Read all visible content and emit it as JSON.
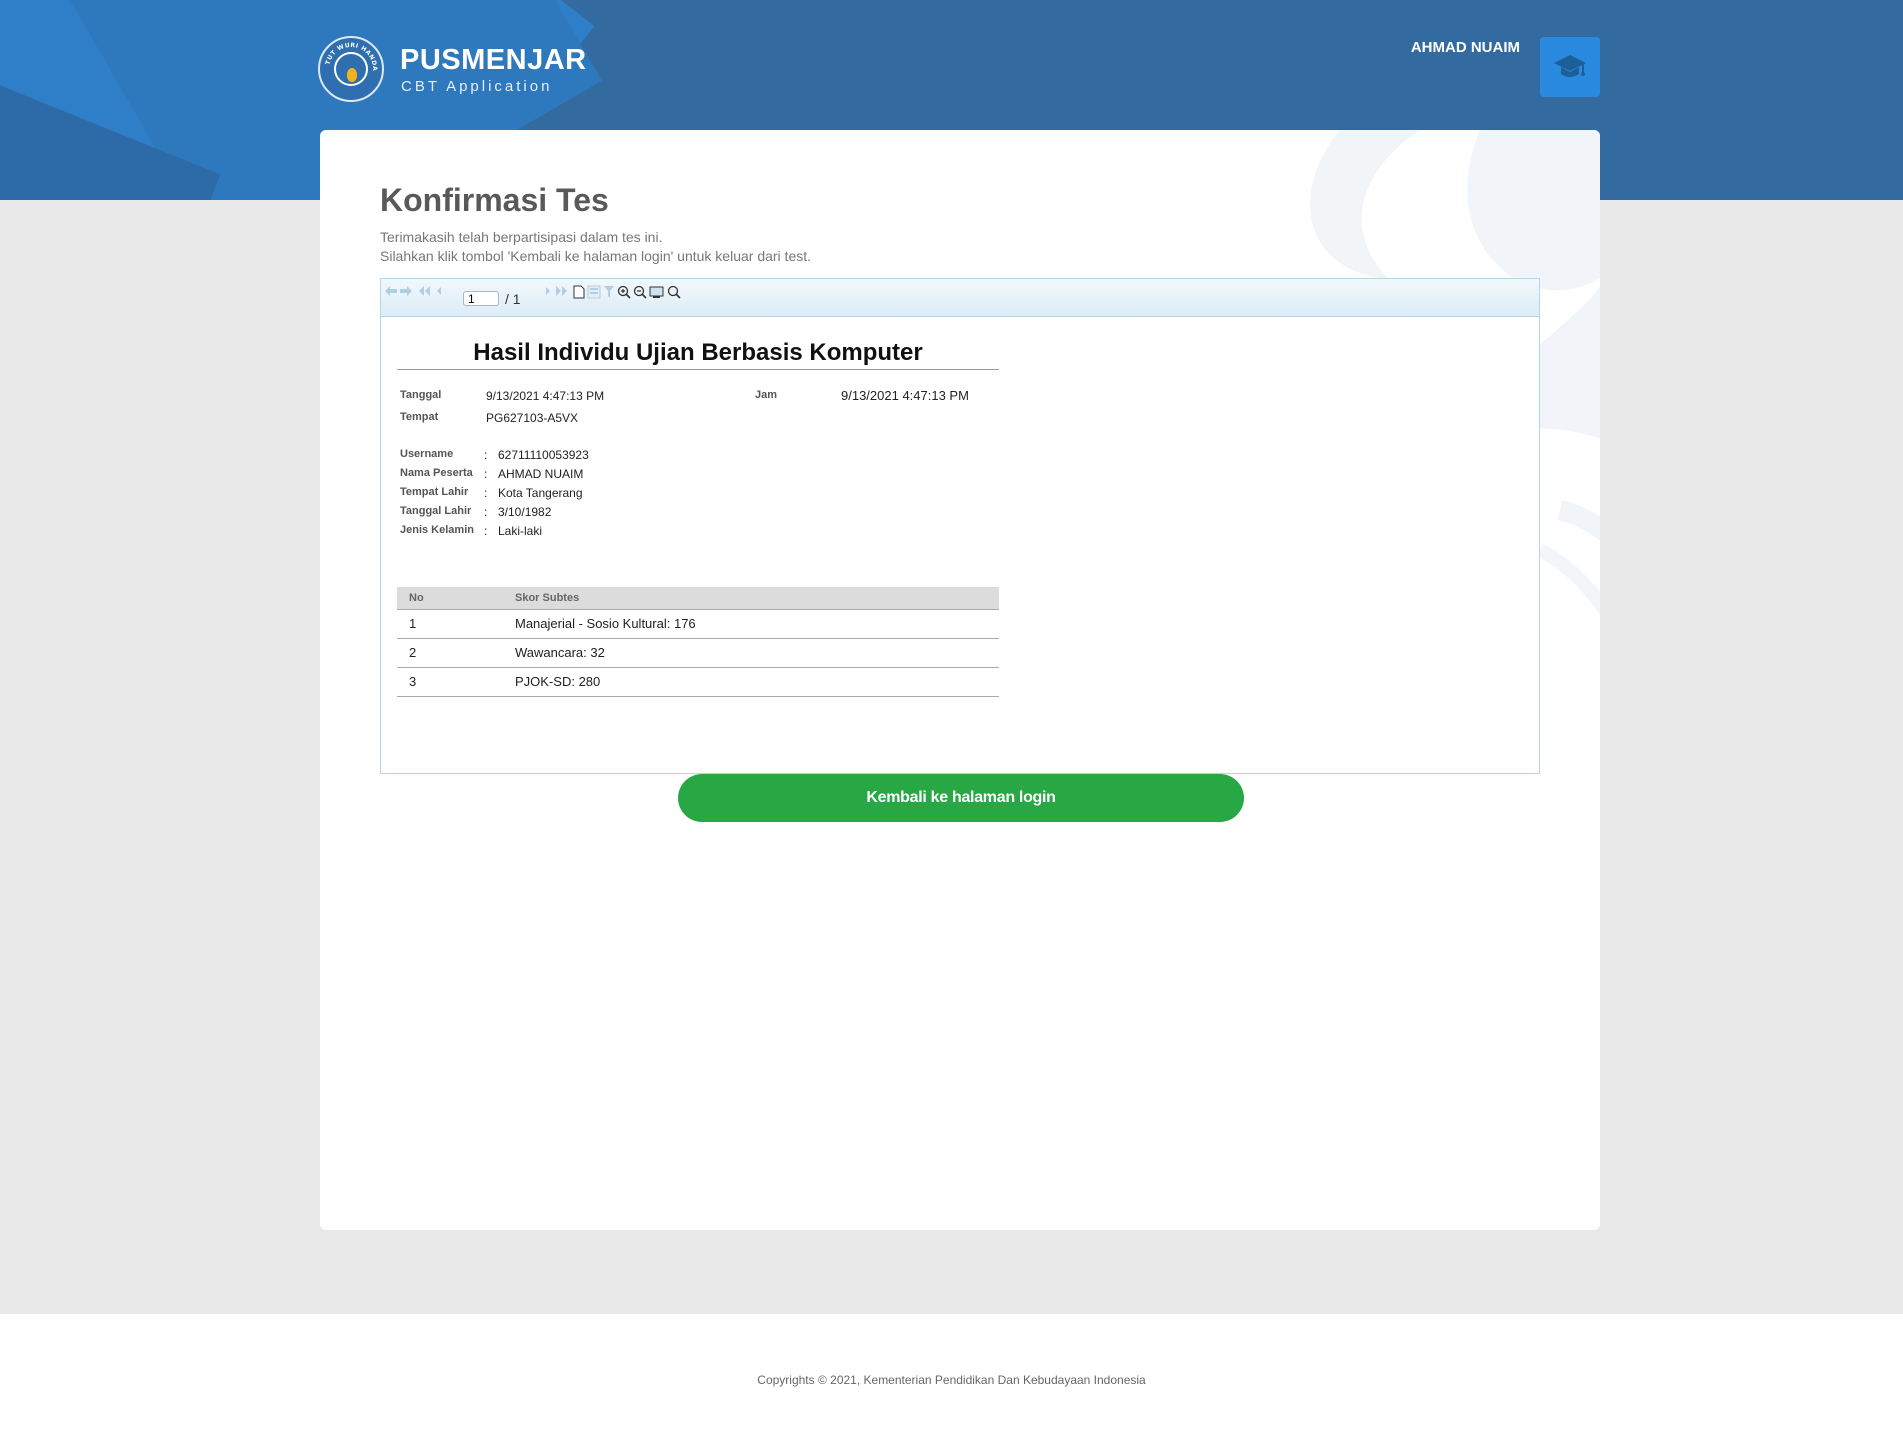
{
  "header": {
    "app_name": "PUSMENJAR",
    "app_subtitle": "CBT Application",
    "emblem_motto": "TUT WURI HANDAYANI",
    "user_name": "AHMAD NUAIM",
    "user_icon": "graduation-cap-icon",
    "colors": {
      "header_bg": "#336ba0",
      "accent": "#2a8ae0"
    }
  },
  "main": {
    "title": "Konfirmasi Tes",
    "desc_line1": "Terimakasih telah berpartisipasi dalam tes ini.",
    "desc_line2": "Silahkan klik tombol 'Kembali ke halaman login' untuk keluar dari test."
  },
  "viewer": {
    "toolbar": {
      "icons": [
        "undo-icon",
        "redo-icon",
        "first-page-icon",
        "prev-page-icon",
        "next-page-icon",
        "last-page-icon",
        "document-icon",
        "export-icon",
        "filter-icon",
        "zoom-in-icon",
        "zoom-out-icon",
        "print-icon",
        "search-icon"
      ],
      "page_value": "1",
      "page_total": "/ 1"
    },
    "report": {
      "title": "Hasil Individu Ujian Berbasis Komputer",
      "tanggal_label": "Tanggal",
      "tanggal_value": "9/13/2021 4:47:13 PM",
      "jam_label": "Jam",
      "jam_value": "9/13/2021 4:47:13 PM",
      "tempat_label": "Tempat",
      "tempat_value": "PG627103-A5VX",
      "colon": ":",
      "fields": [
        {
          "label": "Username",
          "value": "62711110053923"
        },
        {
          "label": "Nama Peserta",
          "value": "AHMAD NUAIM"
        },
        {
          "label": "Tempat Lahir",
          "value": "Kota Tangerang"
        },
        {
          "label": "Tanggal Lahir",
          "value": "3/10/1982"
        },
        {
          "label": "Jenis Kelamin",
          "value": "Laki-laki"
        }
      ],
      "table": {
        "headers": [
          "No",
          "Skor Subtes"
        ],
        "rows": [
          {
            "no": "1",
            "skor": "Manajerial - Sosio Kultural: 176"
          },
          {
            "no": "2",
            "skor": "Wawancara: 32"
          },
          {
            "no": "3",
            "skor": "PJOK-SD: 280"
          }
        ]
      }
    }
  },
  "actions": {
    "back_label": "Kembali ke halaman login",
    "back_color": "#28a745"
  },
  "footer": {
    "copyright": "Copyrights © 2021, Kementerian Pendidikan Dan Kebudayaan Indonesia"
  }
}
